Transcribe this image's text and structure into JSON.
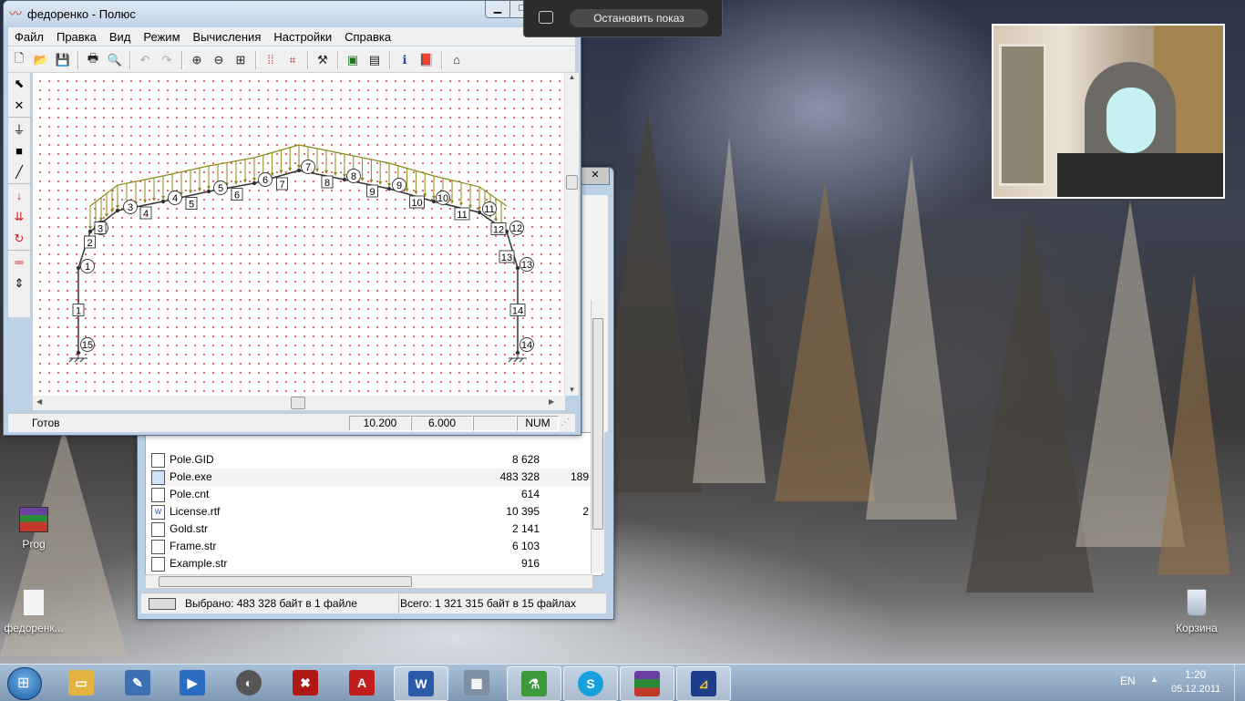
{
  "polus": {
    "title": "федоренко - Полюс",
    "menu": [
      "Файл",
      "Правка",
      "Вид",
      "Режим",
      "Вычисления",
      "Настройки",
      "Справка"
    ],
    "status": {
      "ready": "Готов",
      "x": "10.200",
      "y": "6.000",
      "mode": "",
      "num": "NUM"
    },
    "frame": {
      "node_labels": [
        "1",
        "2",
        "3",
        "4",
        "5",
        "6",
        "7",
        "8",
        "9",
        "10",
        "11",
        "12",
        "13",
        "14",
        "15"
      ],
      "element_labels": [
        "1",
        "2",
        "3",
        "4",
        "5",
        "6",
        "7",
        "8",
        "9",
        "10",
        "11",
        "12",
        "13",
        "14"
      ]
    }
  },
  "explorer": {
    "files": [
      {
        "name": "Pole.GID",
        "size": "8 628",
        "extra": ""
      },
      {
        "name": "Pole.exe",
        "size": "483 328",
        "extra": "189"
      },
      {
        "name": "Pole.cnt",
        "size": "614",
        "extra": ""
      },
      {
        "name": "License.rtf",
        "size": "10 395",
        "extra": "2"
      },
      {
        "name": "Gold.str",
        "size": "2 141",
        "extra": ""
      },
      {
        "name": "Frame.str",
        "size": "6 103",
        "extra": ""
      },
      {
        "name": "Example.str",
        "size": "916",
        "extra": ""
      }
    ],
    "selected": "Выбрано: 483 328 байт в 1 файле",
    "total": "Всего: 1 321 315 байт в 15 файлах"
  },
  "share": {
    "stop": "Остановить показ"
  },
  "desktop": {
    "icons": [
      "Prog",
      "федоренк...",
      "Корзина"
    ]
  },
  "taskbar": {
    "lang": "EN",
    "time": "1:20",
    "date": "05.12.2011"
  },
  "colors": {
    "load": "#8a8a1a",
    "frame": "#333333",
    "grid_dot": "#d45050"
  }
}
